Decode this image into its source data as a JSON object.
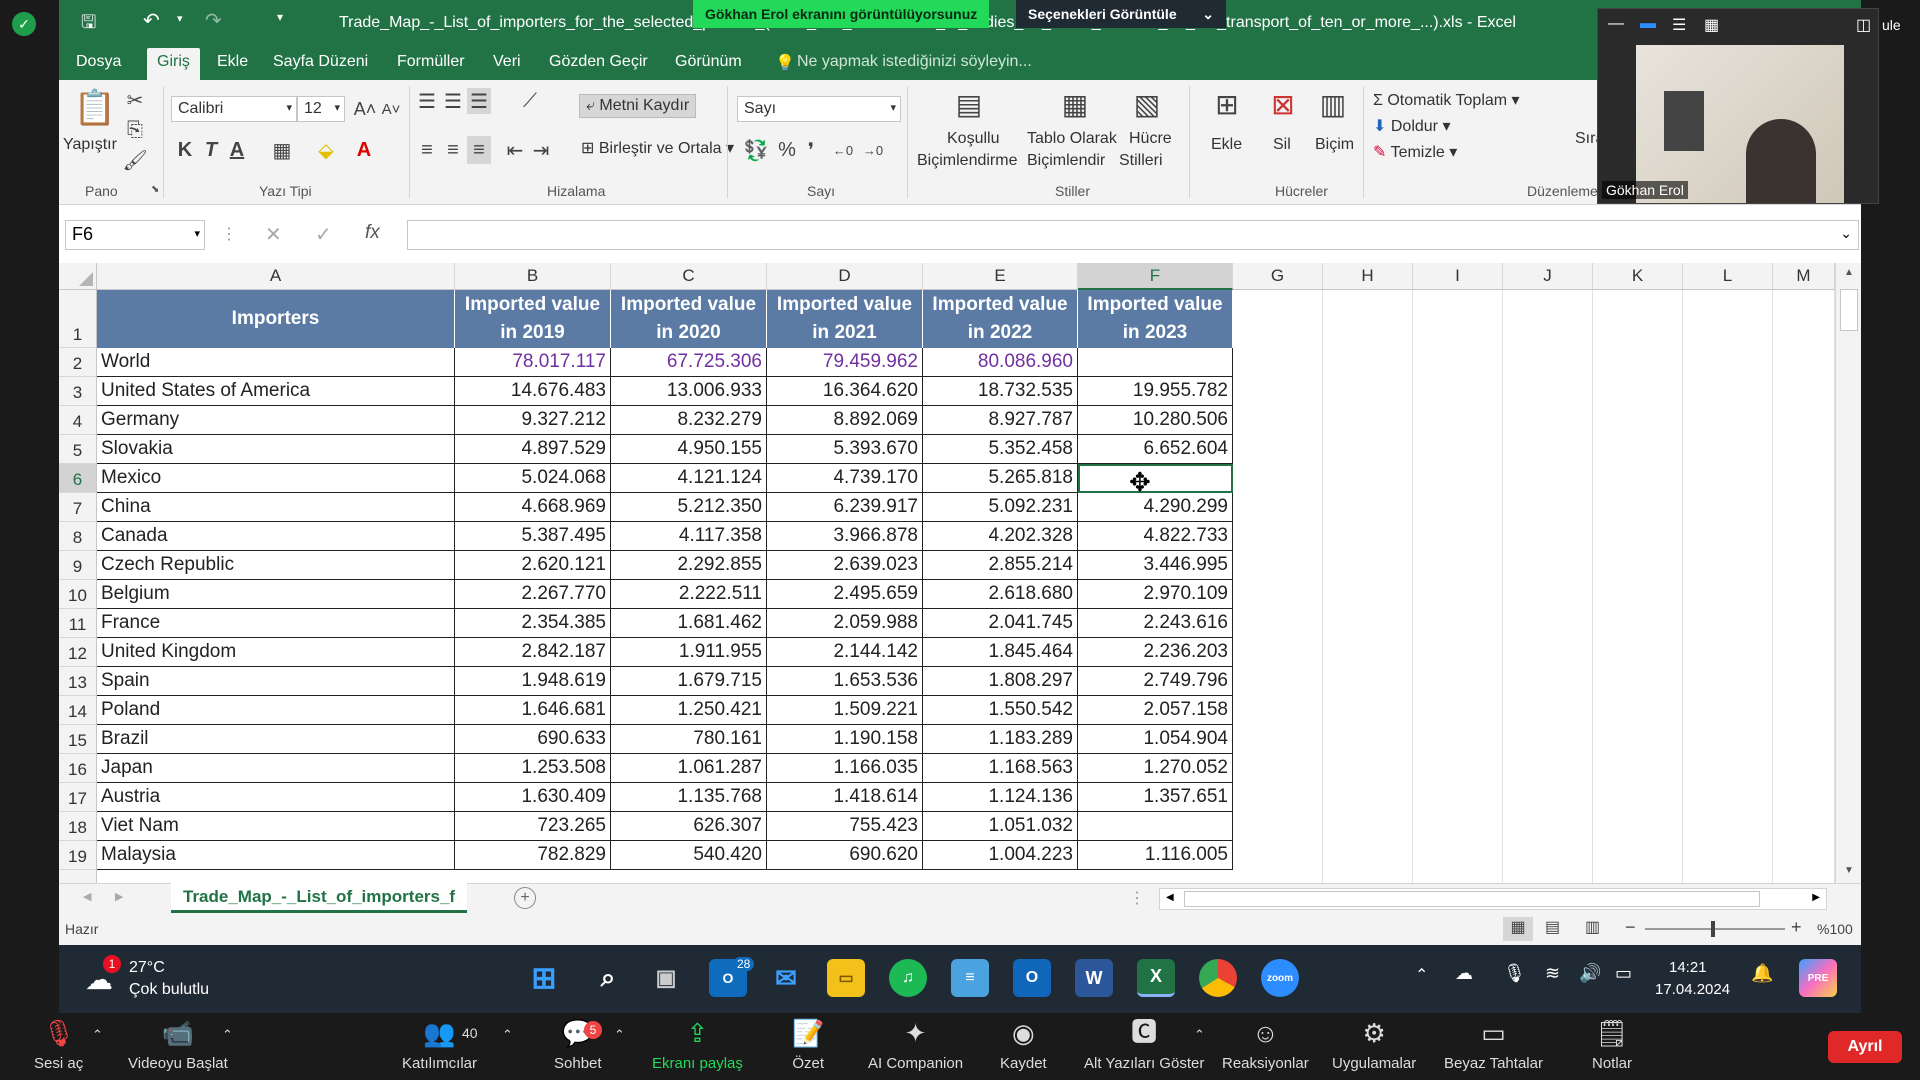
{
  "titlebar": {
    "title": "Trade_Map_-_List_of_importers_for_the_selected_product_(Parts_and_accessories_of_bodies_for_motor_vehicles_for_the_transport_of_ten_or_more_...).xls - Excel",
    "share_status": "Gökhan Erol ekranını görüntülüyorsunuz",
    "view_options": "Seçenekleri Görüntüle",
    "right_text": "ule"
  },
  "menu": [
    "Dosya",
    "Giriş",
    "Ekle",
    "Sayfa Düzeni",
    "Formüller",
    "Veri",
    "Gözden Geçir",
    "Görünüm"
  ],
  "tellme": "Ne yapmak istediğinizi söyleyin...",
  "ribbon": {
    "paste": "Yapıştır",
    "pano": "Pano",
    "font_name": "Calibri",
    "font_size": "12",
    "yazi_tipi": "Yazı Tipi",
    "bold": "K",
    "italic": "T",
    "underline": "A",
    "wrap": "Metni Kaydır",
    "merge": "Birleştir ve Ortala",
    "hizalama": "Hizalama",
    "number_format": "Sayı",
    "sayi": "Sayı",
    "percent": "%",
    "comma": "❜",
    "cond_fmt_1": "Koşullu",
    "cond_fmt_2": "Biçimlendirme",
    "table_fmt_1": "Tablo Olarak",
    "table_fmt_2": "Biçimlendir",
    "cell_styles_1": "Hücre",
    "cell_styles_2": "Stilleri",
    "stiller": "Stiller",
    "insert": "Ekle",
    "delete": "Sil",
    "format": "Biçim",
    "hucreler": "Hücreler",
    "autosum": "Otomatik Toplam",
    "fill": "Doldur",
    "clear": "Temizle",
    "duzenleme": "Düzenleme",
    "sira": "Sıra"
  },
  "formula": {
    "namebox": "F6",
    "fx": "fx",
    "value": ""
  },
  "columns": [
    "A",
    "B",
    "C",
    "D",
    "E",
    "F",
    "G",
    "H",
    "I",
    "J",
    "K",
    "L",
    "M"
  ],
  "headers": {
    "a": "Importers",
    "b": [
      "Imported value",
      "in 2019"
    ],
    "c": [
      "Imported value",
      "in 2020"
    ],
    "d": [
      "Imported value",
      "in 2021"
    ],
    "e": [
      "Imported value",
      "in 2022"
    ],
    "f": [
      "Imported value",
      "in 2023"
    ]
  },
  "rows": [
    {
      "n": "2",
      "name": "World",
      "v": [
        "78.017.117",
        "67.725.306",
        "79.459.962",
        "80.086.960",
        ""
      ]
    },
    {
      "n": "3",
      "name": "United States of America",
      "v": [
        "14.676.483",
        "13.006.933",
        "16.364.620",
        "18.732.535",
        "19.955.782"
      ]
    },
    {
      "n": "4",
      "name": "Germany",
      "v": [
        "9.327.212",
        "8.232.279",
        "8.892.069",
        "8.927.787",
        "10.280.506"
      ]
    },
    {
      "n": "5",
      "name": "Slovakia",
      "v": [
        "4.897.529",
        "4.950.155",
        "5.393.670",
        "5.352.458",
        "6.652.604"
      ]
    },
    {
      "n": "6",
      "name": "Mexico",
      "v": [
        "5.024.068",
        "4.121.124",
        "4.739.170",
        "5.265.818",
        ""
      ]
    },
    {
      "n": "7",
      "name": "China",
      "v": [
        "4.668.969",
        "5.212.350",
        "6.239.917",
        "5.092.231",
        "4.290.299"
      ]
    },
    {
      "n": "8",
      "name": "Canada",
      "v": [
        "5.387.495",
        "4.117.358",
        "3.966.878",
        "4.202.328",
        "4.822.733"
      ]
    },
    {
      "n": "9",
      "name": "Czech Republic",
      "v": [
        "2.620.121",
        "2.292.855",
        "2.639.023",
        "2.855.214",
        "3.446.995"
      ]
    },
    {
      "n": "10",
      "name": "Belgium",
      "v": [
        "2.267.770",
        "2.222.511",
        "2.495.659",
        "2.618.680",
        "2.970.109"
      ]
    },
    {
      "n": "11",
      "name": "France",
      "v": [
        "2.354.385",
        "1.681.462",
        "2.059.988",
        "2.041.745",
        "2.243.616"
      ]
    },
    {
      "n": "12",
      "name": "United Kingdom",
      "v": [
        "2.842.187",
        "1.911.955",
        "2.144.142",
        "1.845.464",
        "2.236.203"
      ]
    },
    {
      "n": "13",
      "name": "Spain",
      "v": [
        "1.948.619",
        "1.679.715",
        "1.653.536",
        "1.808.297",
        "2.749.796"
      ]
    },
    {
      "n": "14",
      "name": "Poland",
      "v": [
        "1.646.681",
        "1.250.421",
        "1.509.221",
        "1.550.542",
        "2.057.158"
      ]
    },
    {
      "n": "15",
      "name": "Brazil",
      "v": [
        "690.633",
        "780.161",
        "1.190.158",
        "1.183.289",
        "1.054.904"
      ]
    },
    {
      "n": "16",
      "name": "Japan",
      "v": [
        "1.253.508",
        "1.061.287",
        "1.166.035",
        "1.168.563",
        "1.270.052"
      ]
    },
    {
      "n": "17",
      "name": "Austria",
      "v": [
        "1.630.409",
        "1.135.768",
        "1.418.614",
        "1.124.136",
        "1.357.651"
      ]
    },
    {
      "n": "18",
      "name": "Viet Nam",
      "v": [
        "723.265",
        "626.307",
        "755.423",
        "1.051.032",
        ""
      ]
    },
    {
      "n": "19",
      "name": "Malaysia",
      "v": [
        "782.829",
        "540.420",
        "690.620",
        "1.004.223",
        "1.116.005"
      ]
    }
  ],
  "sheet_tab": "Trade_Map_-_List_of_importers_f",
  "status": {
    "ready": "Hazır",
    "zoom": "%100"
  },
  "taskbar": {
    "weather_temp": "27°C",
    "weather_desc": "Çok bulutlu",
    "weather_badge": "1",
    "time": "14:21",
    "date": "17.04.2024",
    "outlook_badge": "28"
  },
  "webcam": {
    "name": "Gökhan Erol"
  },
  "zoom": {
    "mute": "Sesi aç",
    "video": "Videoyu Başlat",
    "participants": "Katılımcılar",
    "participants_count": "40",
    "chat": "Sohbet",
    "chat_badge": "5",
    "share": "Ekranı paylaş",
    "summary": "Özet",
    "ai": "AI Companion",
    "record": "Kaydet",
    "captions": "Alt Yazıları Göster",
    "reactions": "Reaksiyonlar",
    "apps": "Uygulamalar",
    "whiteboard": "Beyaz Tahtalar",
    "notes": "Notlar",
    "leave": "Ayrıl"
  }
}
